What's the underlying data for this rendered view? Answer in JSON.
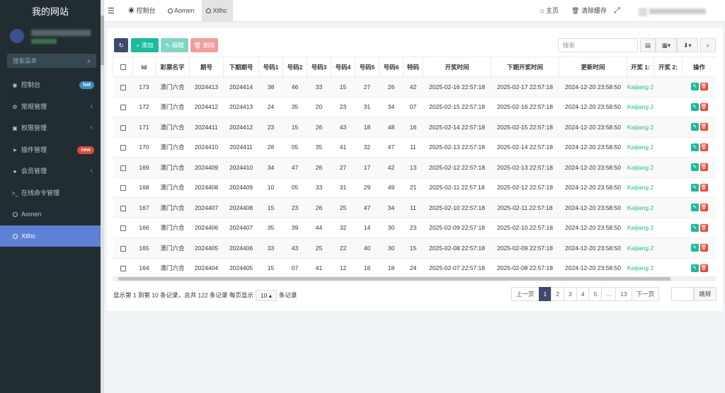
{
  "sidebar": {
    "title": "我的网站",
    "search_placeholder": "搜索菜单",
    "items": [
      {
        "icon": "dashboard-icon",
        "glyph": "◉",
        "label": "控制台",
        "badge": "hot",
        "badge_color": "#3c8dbc",
        "arrow": ""
      },
      {
        "icon": "cogs-icon",
        "glyph": "⚙",
        "label": "常规管理",
        "badge": "",
        "arrow": "‹"
      },
      {
        "icon": "users-icon",
        "glyph": "👥",
        "label": "权限管理",
        "badge": "",
        "arrow": "‹"
      },
      {
        "icon": "rocket-icon",
        "glyph": "➤",
        "label": "插件管理",
        "badge": "new",
        "badge_color": "#dd4b39",
        "arrow": ""
      },
      {
        "icon": "user-circle-icon",
        "glyph": "●",
        "label": "会员管理",
        "badge": "",
        "arrow": "‹"
      },
      {
        "icon": "terminal-icon",
        "glyph": ">_",
        "label": "在线命令管理",
        "badge": "",
        "arrow": ""
      },
      {
        "icon": "circle-icon",
        "glyph": "",
        "label": "Aomen",
        "badge": "",
        "arrow": ""
      },
      {
        "icon": "circle-icon",
        "glyph": "",
        "label": "Xtlhc",
        "badge": "",
        "arrow": "",
        "active": true
      }
    ]
  },
  "topbar": {
    "tabs": [
      {
        "label": "控制台",
        "icon": "dashboard-icon"
      },
      {
        "label": "Aomen",
        "icon": "circle-icon"
      },
      {
        "label": "Xtlhc",
        "icon": "circle-icon",
        "active": true
      }
    ],
    "home_label": "主页",
    "clear_cache_label": "清除缓存"
  },
  "toolbar": {
    "add_label": "添加",
    "edit_label": "编辑",
    "delete_label": "删除",
    "search_placeholder": "搜索"
  },
  "table": {
    "headers": [
      "Id",
      "彩票名字",
      "期号",
      "下期期号",
      "号码1",
      "号码2",
      "号码3",
      "号码4",
      "号码5",
      "号码6",
      "特码",
      "开奖时间",
      "下期开奖时间",
      "更新时间",
      "开奖 1:",
      "开奖 2:",
      "操作"
    ],
    "rows": [
      [
        "173",
        "澳门六合",
        "2024413",
        "2024414",
        "38",
        "46",
        "33",
        "15",
        "27",
        "26",
        "42",
        "2025-02-16 22:57:18",
        "2025-02-17 22:57:18",
        "2024-12-20 23:58:50",
        "Kaijiang 2"
      ],
      [
        "172",
        "澳门六合",
        "2024412",
        "2024413",
        "24",
        "35",
        "20",
        "23",
        "31",
        "34",
        "07",
        "2025-02-15 22:57:18",
        "2025-02-16 22:57:18",
        "2024-12-20 23:58:50",
        "Kaijiang 2"
      ],
      [
        "171",
        "澳门六合",
        "2024411",
        "2024412",
        "23",
        "15",
        "26",
        "43",
        "18",
        "48",
        "16",
        "2025-02-14 22:57:18",
        "2025-02-15 22:57:18",
        "2024-12-20 23:58:50",
        "Kaijiang 2"
      ],
      [
        "170",
        "澳门六合",
        "2024410",
        "2024411",
        "28",
        "05",
        "35",
        "41",
        "32",
        "47",
        "11",
        "2025-02-13 22:57:18",
        "2025-02-14 22:57:18",
        "2024-12-20 23:58:50",
        "Kaijiang 2"
      ],
      [
        "169",
        "澳门六合",
        "2024409",
        "2024410",
        "34",
        "47",
        "26",
        "27",
        "17",
        "42",
        "13",
        "2025-02-12 22:57:18",
        "2025-02-13 22:57:18",
        "2024-12-20 23:58:50",
        "Kaijiang 2"
      ],
      [
        "168",
        "澳门六合",
        "2024408",
        "2024409",
        "10",
        "05",
        "33",
        "31",
        "29",
        "49",
        "21",
        "2025-02-11 22:57:18",
        "2025-02-12 22:57:18",
        "2024-12-20 23:58:50",
        "Kaijiang 2"
      ],
      [
        "167",
        "澳门六合",
        "2024407",
        "2024408",
        "15",
        "23",
        "26",
        "25",
        "47",
        "34",
        "11",
        "2025-02-10 22:57:18",
        "2025-02-11 22:57:18",
        "2024-12-20 23:58:50",
        "Kaijiang 2"
      ],
      [
        "166",
        "澳门六合",
        "2024406",
        "2024407",
        "35",
        "39",
        "44",
        "32",
        "14",
        "30",
        "23",
        "2025-02-09 22:57:18",
        "2025-02-10 22:57:18",
        "2024-12-20 23:58:50",
        "Kaijiang 2"
      ],
      [
        "165",
        "澳门六合",
        "2024405",
        "2024406",
        "33",
        "43",
        "25",
        "22",
        "40",
        "30",
        "15",
        "2025-02-08 22:57:18",
        "2025-02-09 22:57:18",
        "2024-12-20 23:58:50",
        "Kaijiang 2"
      ],
      [
        "164",
        "澳门六合",
        "2024404",
        "2024405",
        "15",
        "07",
        "41",
        "12",
        "16",
        "18",
        "24",
        "2025-02-07 22:57:18",
        "2025-02-08 22:57:18",
        "2024-12-20 23:58:50",
        "Kaijiang 2"
      ]
    ]
  },
  "pagination": {
    "info_prefix": "显示第 1 到第 10 条记录，总共 122 条记录 每页显示",
    "page_size": "10",
    "info_suffix": "条记录",
    "prev": "上一页",
    "pages": [
      "1",
      "2",
      "3",
      "4",
      "5",
      "...",
      "13"
    ],
    "current": "1",
    "next": "下一页",
    "jump_label": "跳转"
  },
  "colors": {
    "sidebar_bg": "#222d32",
    "active_menu": "#5e80d6",
    "add_button": "#18bc9c",
    "edit_button": "#7fd6c5",
    "delete_button": "#f39c9c",
    "link": "#18bc9c",
    "row_edit": "#18bc9c",
    "row_delete": "#e74c3c"
  }
}
